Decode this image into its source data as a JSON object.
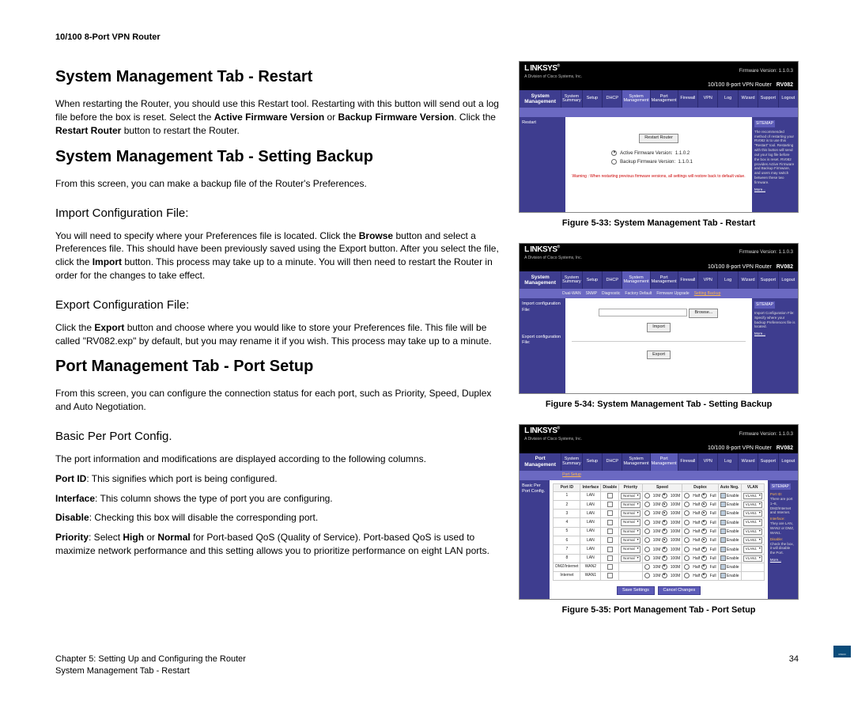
{
  "header": {
    "product": "10/100 8-Port VPN Router"
  },
  "sections": {
    "restart": {
      "title": "System Management Tab - Restart",
      "p1a": "When restarting the Router, you should use this Restart tool. Restarting with this button will send out a log file before the box is reset. Select the ",
      "b1": "Active Firmware Version",
      "p1b": " or ",
      "b2": "Backup Firmware Version",
      "p1c": ". Click the ",
      "b3": "Restart Router",
      "p1d": " button to restart the Router."
    },
    "backup": {
      "title": "System Management Tab - Setting Backup",
      "p1": "From this screen, you can make a backup file of the Router's Preferences.",
      "h_import": "Import Configuration File:",
      "imp_a": "You will need to specify where your Preferences file is located. Click the ",
      "imp_b1": "Browse",
      "imp_b": " button and select a Preferences file. This should have been previously saved using the Export button. After you select the file, click the ",
      "imp_b2": "Import",
      "imp_c": " button. This process may take up to a minute.  You will then need to restart the Router in order for the changes to take effect.",
      "h_export": "Export Configuration File:",
      "exp_a": "Click the ",
      "exp_b1": "Export",
      "exp_b": " button and choose where you would like to store your Preferences file. This file will be called \"RV082.exp\" by default, but you may rename it if you wish. This process may take up to a minute."
    },
    "port": {
      "title": "Port Management Tab - Port Setup",
      "p1": "From this screen, you can configure the connection status for each port, such as Priority, Speed, Duplex and Auto Negotiation.",
      "h_basic": "Basic Per Port Config.",
      "p2": "The port information and modifications are displayed according to the following columns.",
      "portid_b": "Port ID",
      "portid_t": ": This signifies which port is being configured.",
      "iface_b": "Interface",
      "iface_t": ": This column shows the type of port you are configuring.",
      "dis_b": "Disable",
      "dis_t": ": Checking this box will disable the corresponding port.",
      "pri_b": "Priority",
      "pri_t1": ": Select ",
      "pri_b2": "High",
      "pri_t2": " or ",
      "pri_b3": "Normal",
      "pri_t3": " for Port-based QoS (Quality of Service). Port-based QoS is used to maximize network performance and this setting allows you to prioritize performance on eight LAN ports."
    }
  },
  "figures": {
    "f33": "Figure 5-33: System Management Tab - Restart",
    "f34": "Figure 5-34: System Management Tab - Setting Backup",
    "f35": "Figure 5-35: Port Management Tab - Port Setup"
  },
  "footer": {
    "chapter": "Chapter 5: Setting Up and Configuring the Router",
    "section": "System Management Tab - Restart",
    "page": "34"
  },
  "ui": {
    "brand": "LINKSYS",
    "brand_sub": "A Division of Cisco Systems, Inc.",
    "model": "10/100 8-port VPN Router",
    "model_code": "RV082",
    "fw": "Firmware Version: 1.1.0.3",
    "tabs": [
      "System Summary",
      "Setup",
      "DHCP",
      "System Management",
      "Port Management",
      "Firewall",
      "VPN",
      "Log",
      "Wizard",
      "Support",
      "Logout"
    ],
    "sys_mgmt_label": "System Management",
    "port_mgmt_label": "Port Management",
    "sitemap": "SITEMAP",
    "more": "More...",
    "cisco": "CISCO",
    "fig33": {
      "sidebar": "Restart",
      "btn": "Restart Router",
      "opt1": "Active Firmware Version:",
      "ver1": "1.1.0.2",
      "opt2": "Backup Firmware Version:",
      "ver2": "1.1.0.1",
      "warn": "Warning : When restarting previous firmware versions, all settings will restore back to default value.",
      "help": "The recommended method of restarting your RV082 is to use this \"Restart\" tool. Restarting with this button will send out your log file before the box is reset. RV082 provides Active Firmware and Backup Firmware, and users may switch between these two firmware."
    },
    "fig34": {
      "sub_items": [
        "Dual-WAN",
        "SNMP",
        "Diagnostic",
        "Factory Default",
        "Firmware Upgrade",
        "Setting Backup"
      ],
      "imp_label": "Import configuration File:",
      "exp_label": "Export configuration File:",
      "browse": "Browse...",
      "import": "Import",
      "export": "Export",
      "help": "Import Configuration File: Specify where your backup Preferences file is located."
    },
    "fig35": {
      "sub_items": [
        "Port Setup"
      ],
      "sidebar": "Basic Per Port Config.",
      "headers": [
        "Port ID",
        "Interface",
        "Disable",
        "Priority",
        "Speed",
        "Duplex",
        "Auto Neg.",
        "VLAN"
      ],
      "rows": [
        [
          "1",
          "LAN",
          "",
          "Normal",
          "10M 100M",
          "Half Full",
          "Enable",
          "VLAN1"
        ],
        [
          "2",
          "LAN",
          "",
          "Normal",
          "10M 100M",
          "Half Full",
          "Enable",
          "VLAN1"
        ],
        [
          "3",
          "LAN",
          "",
          "Normal",
          "10M 100M",
          "Half Full",
          "Enable",
          "VLAN1"
        ],
        [
          "4",
          "LAN",
          "",
          "Normal",
          "10M 100M",
          "Half Full",
          "Enable",
          "VLAN1"
        ],
        [
          "5",
          "LAN",
          "",
          "Normal",
          "10M 100M",
          "Half Full",
          "Enable",
          "VLAN1"
        ],
        [
          "6",
          "LAN",
          "",
          "Normal",
          "10M 100M",
          "Half Full",
          "Enable",
          "VLAN1"
        ],
        [
          "7",
          "LAN",
          "",
          "Normal",
          "10M 100M",
          "Half Full",
          "Enable",
          "VLAN1"
        ],
        [
          "8",
          "LAN",
          "",
          "Normal",
          "10M 100M",
          "Half Full",
          "Enable",
          "VLAN1"
        ],
        [
          "DMZ/Internet",
          "WAN2",
          "",
          "",
          "10M 100M",
          "Half Full",
          "Enable",
          ""
        ],
        [
          "Internet",
          "WAN1",
          "",
          "",
          "10M 100M",
          "Half Full",
          "Enable",
          ""
        ]
      ],
      "help_a": "Port ID:",
      "help_b": "There are port 1~8, DMZ/Internet and Internet.",
      "help_c": "Interface:",
      "help_d": "They are LAN, WAN2 or DMZ, WAN1.",
      "help_e": "Disable:",
      "help_f": "Check the box, it will disable the Port.",
      "save": "Save Settings",
      "cancel": "Cancel Changes"
    }
  }
}
